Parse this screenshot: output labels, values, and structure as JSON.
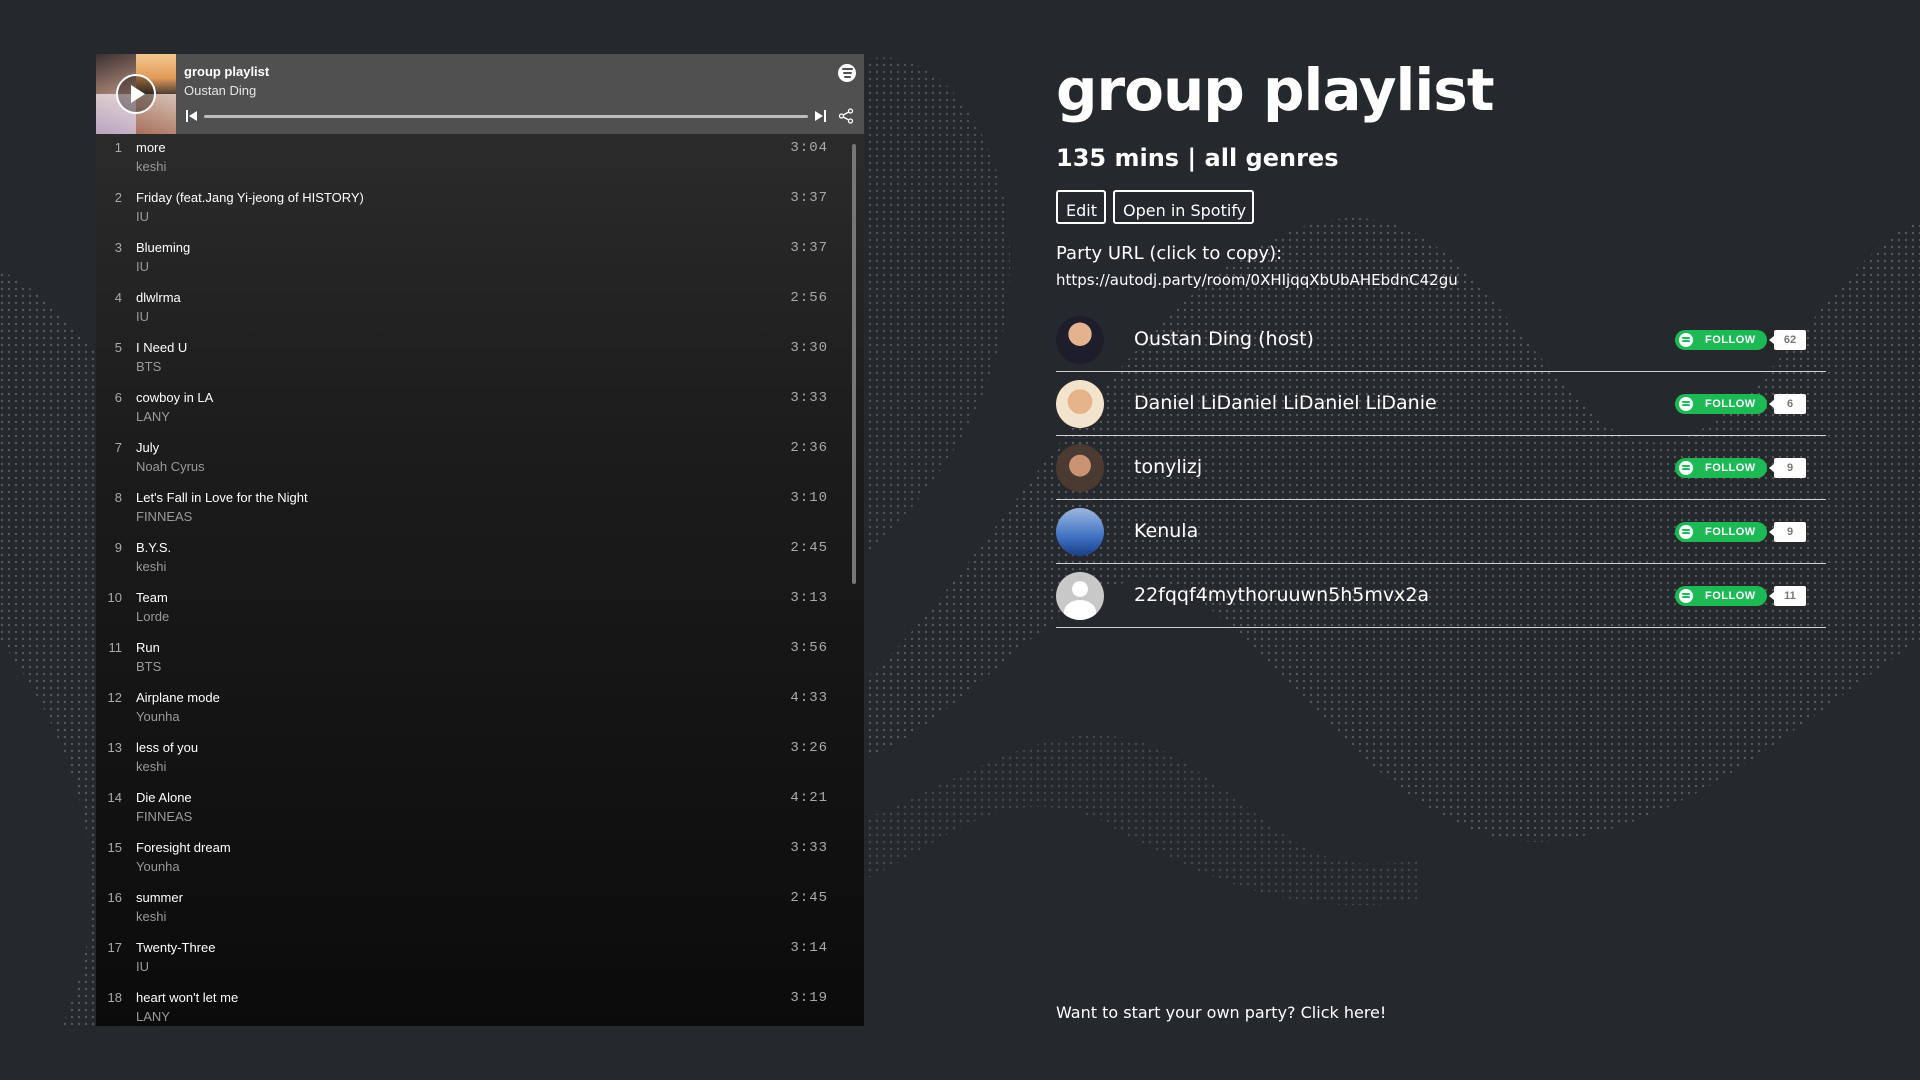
{
  "player": {
    "title": "group playlist",
    "owner": "Oustan Ding"
  },
  "tracks": [
    {
      "num": "1",
      "name": "more",
      "artist": "keshi",
      "duration": "3:04"
    },
    {
      "num": "2",
      "name": "Friday (feat.Jang Yi-jeong of HISTORY)",
      "artist": "IU",
      "duration": "3:37"
    },
    {
      "num": "3",
      "name": "Blueming",
      "artist": "IU",
      "duration": "3:37"
    },
    {
      "num": "4",
      "name": "dlwlrma",
      "artist": "IU",
      "duration": "2:56"
    },
    {
      "num": "5",
      "name": "I Need U",
      "artist": "BTS",
      "duration": "3:30"
    },
    {
      "num": "6",
      "name": "cowboy in LA",
      "artist": "LANY",
      "duration": "3:33"
    },
    {
      "num": "7",
      "name": "July",
      "artist": "Noah Cyrus",
      "duration": "2:36"
    },
    {
      "num": "8",
      "name": "Let's Fall in Love for the Night",
      "artist": "FINNEAS",
      "duration": "3:10"
    },
    {
      "num": "9",
      "name": "B.Y.S.",
      "artist": "keshi",
      "duration": "2:45"
    },
    {
      "num": "10",
      "name": "Team",
      "artist": "Lorde",
      "duration": "3:13"
    },
    {
      "num": "11",
      "name": "Run",
      "artist": "BTS",
      "duration": "3:56"
    },
    {
      "num": "12",
      "name": "Airplane mode",
      "artist": "Younha",
      "duration": "4:33"
    },
    {
      "num": "13",
      "name": "less of you",
      "artist": "keshi",
      "duration": "3:26"
    },
    {
      "num": "14",
      "name": "Die Alone",
      "artist": "FINNEAS",
      "duration": "4:21"
    },
    {
      "num": "15",
      "name": "Foresight dream",
      "artist": "Younha",
      "duration": "3:33"
    },
    {
      "num": "16",
      "name": "summer",
      "artist": "keshi",
      "duration": "2:45"
    },
    {
      "num": "17",
      "name": "Twenty-Three",
      "artist": "IU",
      "duration": "3:14"
    },
    {
      "num": "18",
      "name": "heart won't let me",
      "artist": "LANY",
      "duration": "3:19"
    }
  ],
  "main": {
    "title": "group playlist",
    "subtitle": "135 mins | all genres",
    "edit_label": "Edit",
    "open_label": "Open in Spotify",
    "party_label": "Party URL (click to copy):",
    "party_url": "https://autodj.party/room/0XHIjqqXbUbAHEbdnC42gu",
    "footer": "Want to start your own party? Click here!"
  },
  "users": [
    {
      "name": "Oustan Ding (host)",
      "follow": "FOLLOW",
      "count": "62"
    },
    {
      "name": "Daniel LiDaniel LiDaniel LiDanie",
      "follow": "FOLLOW",
      "count": "6"
    },
    {
      "name": "tonylizj",
      "follow": "FOLLOW",
      "count": "9"
    },
    {
      "name": "Kenula",
      "follow": "FOLLOW",
      "count": "9"
    },
    {
      "name": "22fqqf4mythoruuwn5h5mvx2a",
      "follow": "FOLLOW",
      "count": "11"
    }
  ],
  "colors": {
    "background": "#25282c",
    "spotify_green": "#1db954",
    "player_header": "#505050"
  }
}
